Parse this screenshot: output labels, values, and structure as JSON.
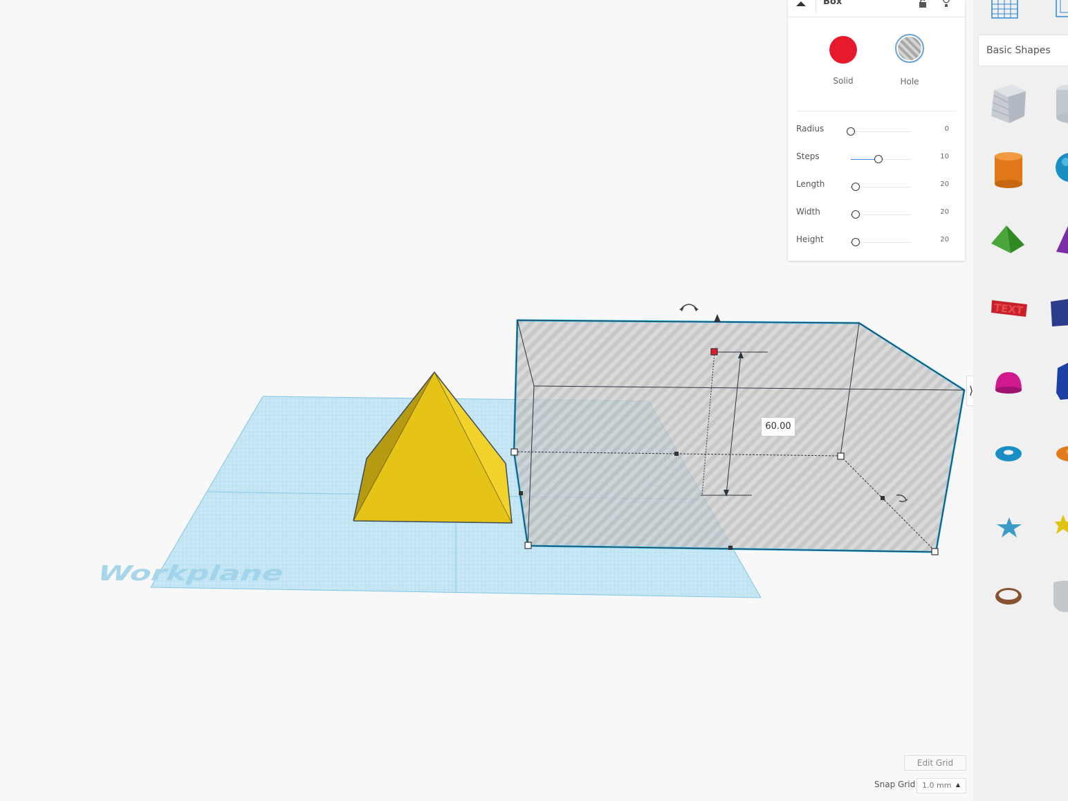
{
  "inspector": {
    "title": "Box",
    "modes": {
      "solid_label": "Solid",
      "hole_label": "Hole"
    },
    "params": [
      {
        "label": "Radius",
        "value": "0",
        "fraction": 0.0
      },
      {
        "label": "Steps",
        "value": "10",
        "fraction": 0.45
      },
      {
        "label": "Length",
        "value": "20",
        "fraction": 0.08
      },
      {
        "label": "Width",
        "value": "20",
        "fraction": 0.08
      },
      {
        "label": "Height",
        "value": "20",
        "fraction": 0.08
      }
    ]
  },
  "viewport": {
    "workplane_label": "Workplane",
    "dimension_value": "60.00"
  },
  "library": {
    "category": "Basic Shapes"
  },
  "grid": {
    "edit_label": "Edit Grid",
    "snap_label": "Snap Grid",
    "snap_value": "1.0 mm"
  },
  "colors": {
    "solid": "#e8192c",
    "selection": "#27b5e8",
    "workplane": "#7fcbea",
    "pyramid": "#e6c417"
  }
}
